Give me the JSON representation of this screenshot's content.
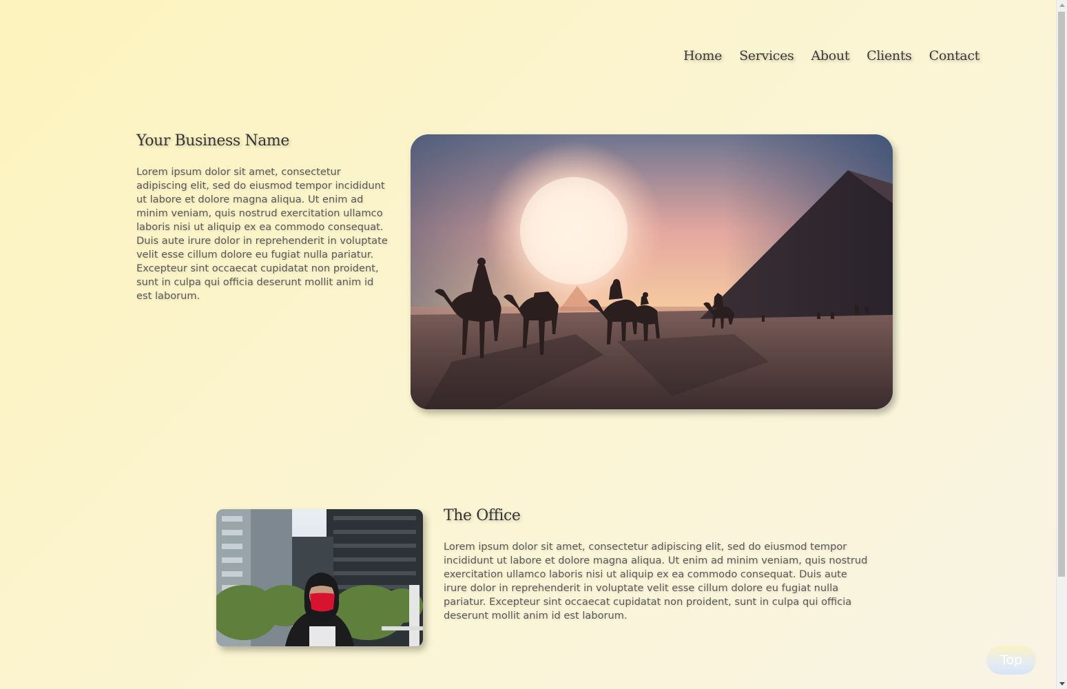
{
  "nav": {
    "items": [
      "Home",
      "Services",
      "About",
      "Clients",
      "Contact"
    ]
  },
  "hero": {
    "title": "Your Business Name",
    "text": "Lorem ipsum dolor sit amet, consectetur adipiscing elit, sed do eiusmod tempor incididunt ut labore et dolore magna aliqua. Ut enim ad minim veniam, quis nostrud exercitation ullamco laboris nisi ut aliquip ex ea commodo consequat. Duis aute irure dolor in reprehenderit in voluptate velit esse cillum dolore eu fugiat nulla pariatur. Excepteur sint occaecat cupidatat non proident, sunt in culpa qui officia deserunt mollit anim id est laborum."
  },
  "office": {
    "title": "The Office",
    "text": "Lorem ipsum dolor sit amet, consectetur adipiscing elit, sed do eiusmod tempor incididunt ut labore et dolore magna aliqua. Ut enim ad minim veniam, quis nostrud exercitation ullamco laboris nisi ut aliquip ex ea commodo consequat. Duis aute irure dolor in reprehenderit in voluptate velit esse cillum dolore eu fugiat nulla pariatur. Excepteur sint occaecat cupidatat non proident, sunt in culpa qui officia deserunt mollit anim id est laborum."
  },
  "top_button": {
    "label": "Top"
  }
}
